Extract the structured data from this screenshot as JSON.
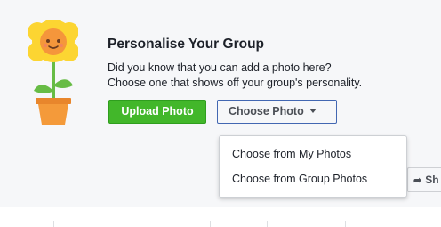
{
  "header": {
    "title": "Personalise Your Group",
    "description_line1": "Did you know that you can add a photo here?",
    "description_line2": "Choose one that shows off your group's personality."
  },
  "actions": {
    "upload_label": "Upload Photo",
    "choose_label": "Choose Photo"
  },
  "choose_menu": {
    "items": [
      "Choose from My Photos",
      "Choose from Group Photos"
    ]
  },
  "share": {
    "label": "Sh",
    "icon": "share-arrow-icon"
  },
  "illustration": {
    "icon": "flower-pot-icon"
  },
  "colors": {
    "upload_button": "#42b72a",
    "choose_button_border": "#4267b2",
    "panel_background": "#f6f7f9",
    "petals": "#fcd532",
    "flower_face": "#f5963b",
    "pot": "#f49a3a",
    "leaves": "#67bc45"
  }
}
